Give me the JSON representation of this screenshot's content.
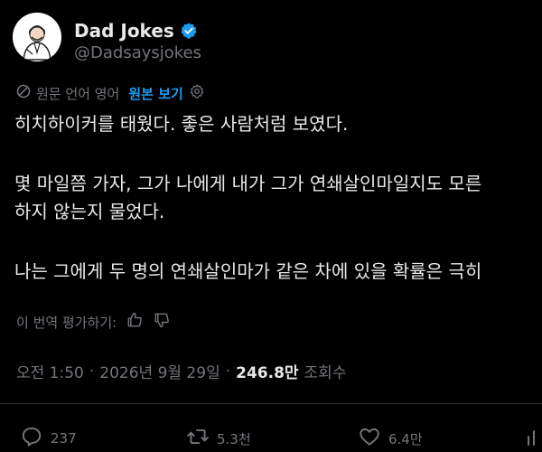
{
  "author": {
    "name": "Dad Jokes",
    "handle": "@Dadsaysjokes"
  },
  "translation": {
    "original_language": "원문 언어 영어",
    "show_original": "원본 보기"
  },
  "tweet": {
    "lines": [
      "히치하이커를 태웠다. 좋은 사람처럼 보였다.",
      "몇 마일쯤 가자, 그가 나에게 내가 그가 연쇄살인마일지도 모른",
      "하지 않는지 물었다.",
      "나는 그에게 두 명의 연쇄살인마가 같은 차에 있을 확률은 극히"
    ]
  },
  "rate": {
    "label": "이 번역 평가하기:"
  },
  "meta": {
    "time": "오전 1:50",
    "dot": "·",
    "date": "2026년 9월 29일",
    "views_count": "246.8만",
    "views_label": "조회수"
  },
  "actions": {
    "replies": "237",
    "retweets": "5.3천",
    "likes": "6.4만"
  },
  "colors": {
    "accent": "#1d9bf0",
    "background": "#000000",
    "text": "#e7e9ea",
    "muted": "#71767b"
  }
}
